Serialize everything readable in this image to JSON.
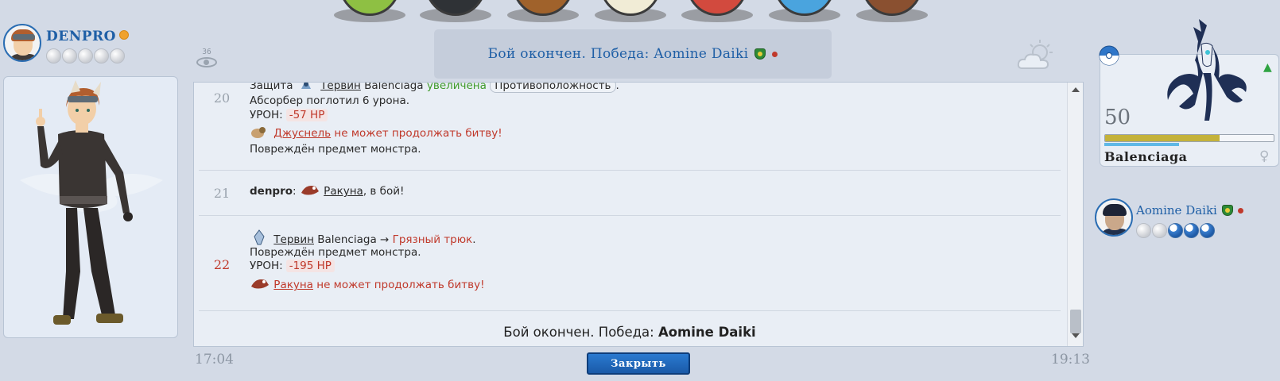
{
  "player": {
    "name": "DENPRO"
  },
  "turn_counter": {
    "value": "36"
  },
  "battle_title": "Бой окончен. Победа: Aomine Daiki",
  "log": [
    {
      "turn": "20",
      "lines": {
        "l1_prefix": "Защита ",
        "l1_mon": "Тервин",
        "l1_owner": " Balenciaga ",
        "l1_effect": "увеличена",
        "l1_tag": "Противоположность",
        "l1_end": ".",
        "l2": "Абсорбер поглотил 6 урона.",
        "l3_label": "УРОН:",
        "l3_value": "-57 HP",
        "l4_mon": "Джуснель",
        "l4_text": " не может продолжать битву!",
        "l5": "Повреждён предмет монстра."
      }
    },
    {
      "turn": "21",
      "lines": {
        "trainer": "denpro",
        "colon": ": ",
        "mon": "Ракуна",
        "text": ", в бой!"
      }
    },
    {
      "turn": "22",
      "lines": {
        "l1_mon": "Тервин",
        "l1_owner": " Balenciaga → ",
        "l1_move": "Грязный трюк",
        "l1_end": ".",
        "l2": "Повреждён предмет монстра.",
        "l3_label": "УРОН:",
        "l3_value": "-195 HP",
        "l4_mon": "Ракуна",
        "l4_text": " не может продолжать битву!"
      }
    }
  ],
  "final_message": {
    "prefix": "Бой окончен. Победа: ",
    "winner": "Aomine Daiki"
  },
  "time_left": "17:04",
  "time_right": "19:13",
  "close_button": "Закрыть",
  "opponent_monster": {
    "level": "50",
    "name": "Balenciaga",
    "hp_fraction": 0.68,
    "xp_fraction": 0.44,
    "up_arrow": "▲",
    "gender_symbol": "♀"
  },
  "opponent": {
    "name": "Aomine Daiki"
  },
  "colors": {
    "accent_blue": "#1f5fa6",
    "damage_red": "#c0392b",
    "buff_green": "#3f9b2a",
    "hp_yellow": "#c4b23a"
  }
}
